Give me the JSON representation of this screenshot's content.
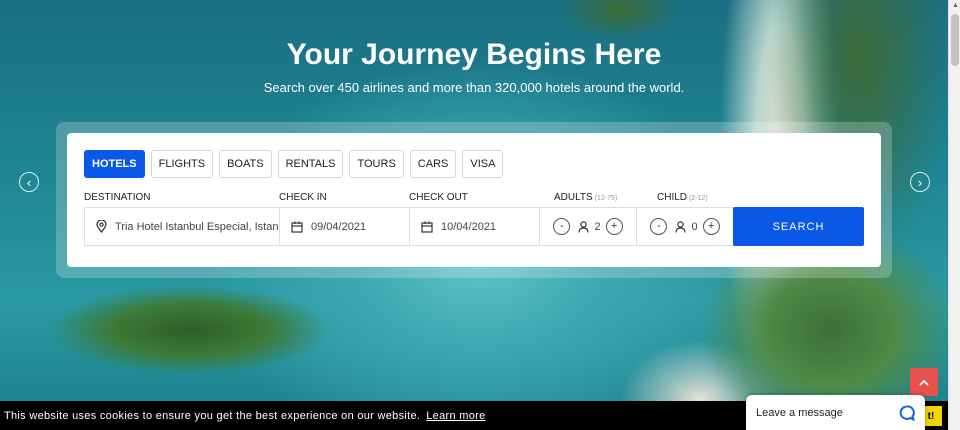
{
  "hero": {
    "title": "Your Journey Begins Here",
    "subtitle": "Search over 450 airlines and more than 320,000 hotels around the world."
  },
  "carousel": {
    "prev_icon": "chevron-left-icon",
    "next_icon": "chevron-right-icon",
    "prev_glyph": "‹",
    "next_glyph": "›"
  },
  "search": {
    "tabs": [
      {
        "label": "HOTELS",
        "active": true
      },
      {
        "label": "FLIGHTS",
        "active": false
      },
      {
        "label": "BOATS",
        "active": false
      },
      {
        "label": "RENTALS",
        "active": false
      },
      {
        "label": "TOURS",
        "active": false
      },
      {
        "label": "CARS",
        "active": false
      },
      {
        "label": "VISA",
        "active": false
      }
    ],
    "labels": {
      "destination": "DESTINATION",
      "checkin": "CHECK IN",
      "checkout": "CHECK OUT",
      "adults": "ADULTS",
      "adults_range": "(12-75)",
      "child": "CHILD",
      "child_range": "(2-12)"
    },
    "destination_value": "Tria Hotel Istanbul Especial, Istan",
    "checkin_value": "09/04/2021",
    "checkout_value": "10/04/2021",
    "adults_value": "2",
    "child_value": "0",
    "minus": "-",
    "plus": "+",
    "search_label": "SEARCH"
  },
  "cookie": {
    "text": "This website uses cookies to ensure you get the best experience on our website.",
    "link": "Learn more",
    "button_partial": "t!"
  },
  "chat": {
    "label": "Leave a message"
  },
  "colors": {
    "accent": "#0a58e8",
    "scroll_top": "#e9514b",
    "cookie_button": "#f1d600"
  }
}
